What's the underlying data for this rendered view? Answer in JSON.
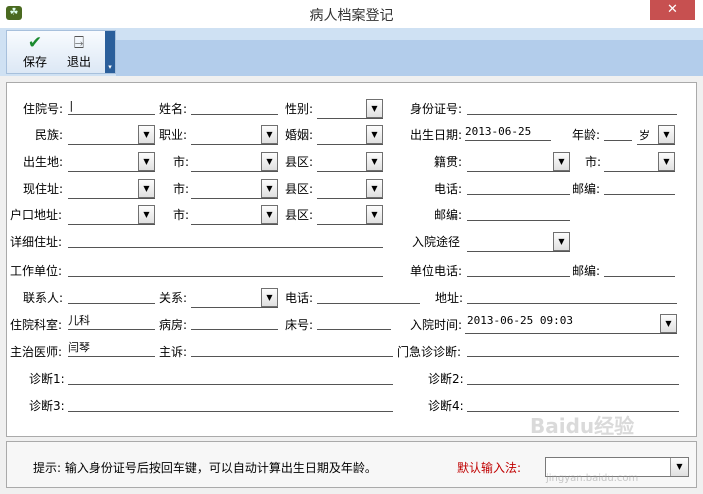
{
  "window": {
    "title": "病人档案登记",
    "close_glyph": "✕"
  },
  "toolbar": {
    "save_label": "保存",
    "exit_label": "退出",
    "more_glyph": "▾"
  },
  "form": {
    "admission_no_label": "住院号:",
    "admission_no_value": "|",
    "name_label": "姓名:",
    "gender_label": "性别:",
    "id_no_label": "身份证号:",
    "ethnicity_label": "民族:",
    "occupation_label": "职业:",
    "marital_label": "婚姻:",
    "birth_date_label": "出生日期:",
    "birth_date_value": "2013-06-25",
    "age_label": "年龄:",
    "age_unit_value": "岁",
    "birthplace_label": "出生地:",
    "city_label": "市:",
    "county_label": "县区:",
    "native_place_label": "籍贯:",
    "current_address_label": "现住址:",
    "phone_label": "电话:",
    "postcode_label": "邮编:",
    "household_address_label": "户口地址:",
    "detail_address_label": "详细住址:",
    "admission_route_label": "入院途径",
    "workplace_label": "工作单位:",
    "work_phone_label": "单位电话:",
    "contact_label": "联系人:",
    "relation_label": "关系:",
    "address_label": "地址:",
    "department_label": "住院科室:",
    "department_value": "儿科",
    "ward_label": "病房:",
    "bed_label": "床号:",
    "admission_time_label": "入院时间:",
    "admission_time_value": "2013-06-25 09:03",
    "doctor_label": "主治医师:",
    "doctor_value": "闫琴",
    "complaint_label": "主诉:",
    "outpatient_diag_label": "门急诊诊断:",
    "diag1_label": "诊断1:",
    "diag2_label": "诊断2:",
    "diag3_label": "诊断3:",
    "diag4_label": "诊断4:",
    "dropdown_glyph": "▼"
  },
  "status": {
    "hint": "提示: 输入身份证号后按回车键，可以自动计算出生日期及年龄。",
    "ime_label": "默认输入法:",
    "ime_value": ""
  },
  "watermark": {
    "text": "Baidu经验",
    "url": "jingyan.baidu.com"
  }
}
